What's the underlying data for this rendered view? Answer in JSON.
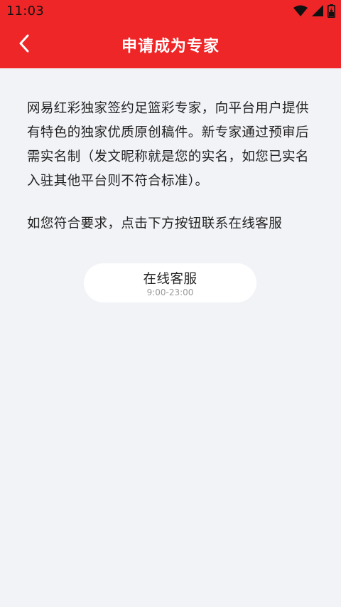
{
  "status_bar": {
    "time": "11:03",
    "icons": [
      "wifi-icon",
      "cell-signal-icon",
      "battery-charging-icon"
    ]
  },
  "nav": {
    "title": "申请成为专家",
    "back_icon": "chevron-left-icon"
  },
  "content": {
    "paragraph_1": "网易红彩独家签约足篮彩专家，向平台用户提供有特色的独家优质原创稿件。新专家通过预审后需实名制（发文昵称就是您的实名，如您已实名入驻其他平台则不符合标准）。",
    "paragraph_2": "如您符合要求，点击下方按钮联系在线客服"
  },
  "service_button": {
    "label": "在线客服",
    "hours": "9:00-23:00"
  },
  "colors": {
    "header_red": "#ef2628",
    "background": "#f2f3f7",
    "button_bg": "#ffffff"
  }
}
